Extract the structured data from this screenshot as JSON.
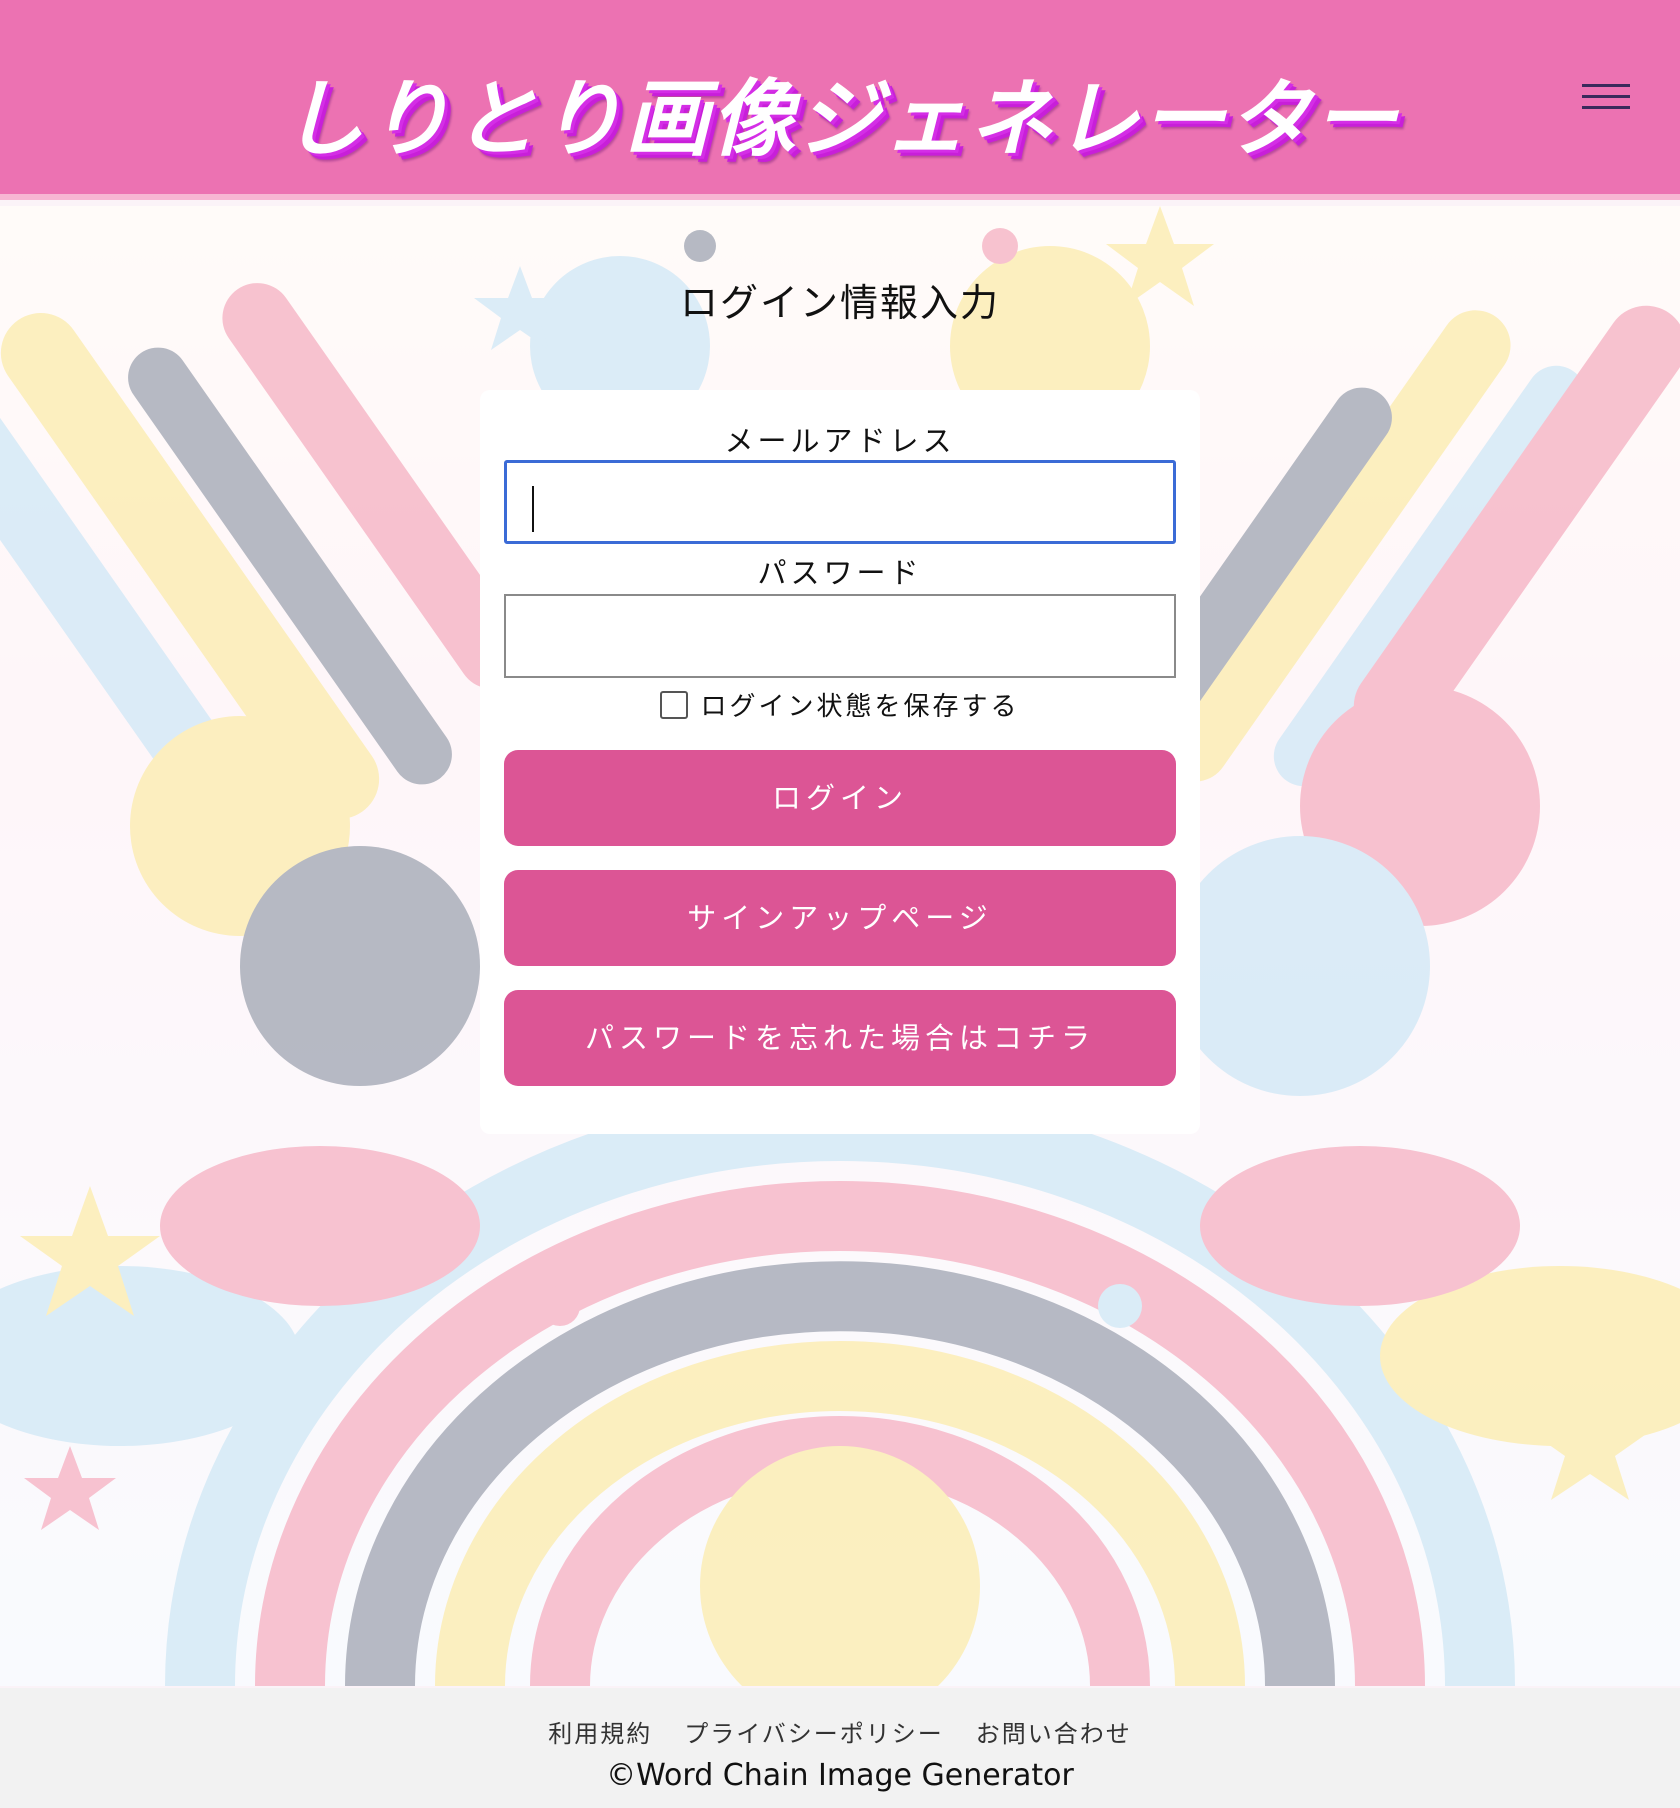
{
  "header": {
    "title": "しりとり画像ジェネレーター",
    "menu_icon": "hamburger-menu-icon"
  },
  "main": {
    "heading": "ログイン情報入力",
    "email": {
      "label": "メールアドレス",
      "value": ""
    },
    "password": {
      "label": "パスワード",
      "value": ""
    },
    "remember_label": "ログイン状態を保存する",
    "remember_checked": false,
    "buttons": {
      "login": "ログイン",
      "signup": "サインアップページ",
      "forgot": "パスワードを忘れた場合はコチラ"
    }
  },
  "footer": {
    "links": [
      "利用規約",
      "プライバシーポリシー",
      "お問い合わせ"
    ],
    "copyright": "©Word Chain Image Generator"
  },
  "colors": {
    "header_bg": "#ec72b2",
    "button_bg": "#dc5595",
    "focus_border": "#3b6bd6",
    "footer_bg": "#f2f2f2"
  }
}
